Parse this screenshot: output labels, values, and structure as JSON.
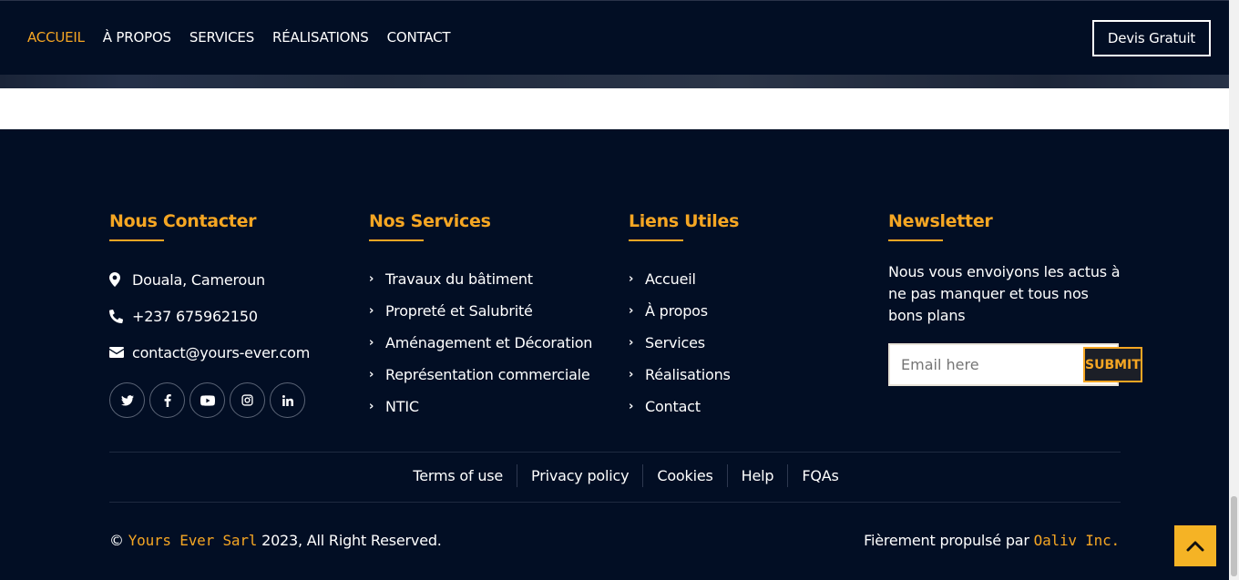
{
  "nav": {
    "items": [
      {
        "label": "ACCUEIL",
        "active": true
      },
      {
        "label": "À PROPOS"
      },
      {
        "label": "SERVICES"
      },
      {
        "label": "RÉALISATIONS"
      },
      {
        "label": "CONTACT"
      }
    ],
    "cta": "Devis Gratuit"
  },
  "footer": {
    "contact": {
      "title": "Nous Contacter",
      "address": "Douala, Cameroun",
      "phone": "+237 675962150",
      "email": "contact@yours-ever.com",
      "socials": [
        "twitter-icon",
        "facebook-icon",
        "youtube-icon",
        "instagram-icon",
        "linkedin-icon"
      ]
    },
    "services": {
      "title": "Nos Services",
      "items": [
        "Travaux du bâtiment",
        "Propreté et Salubrité",
        "Aménagement et Décoration",
        "Représentation commerciale",
        "NTIC"
      ]
    },
    "links": {
      "title": "Liens Utiles",
      "items": [
        "Accueil",
        "À propos",
        "Services",
        "Réalisations",
        "Contact"
      ]
    },
    "newsletter": {
      "title": "Newsletter",
      "text": "Nous vous envoiyons les actus à ne pas manquer et tous nos bons plans",
      "placeholder": "Email here",
      "submit": "SUBMIT"
    },
    "bottom_links": [
      "Terms of use",
      "Privacy policy",
      "Cookies",
      "Help",
      "FQAs"
    ],
    "copyright": {
      "prefix": "©",
      "brand": "Yours Ever Sarl",
      "suffix": "2023, All Right Reserved."
    },
    "powered": {
      "prefix": "Fièrement propulsé par",
      "brand": "Oaliv Inc."
    }
  },
  "colors": {
    "accent": "#f5a623",
    "background": "#020e24"
  }
}
